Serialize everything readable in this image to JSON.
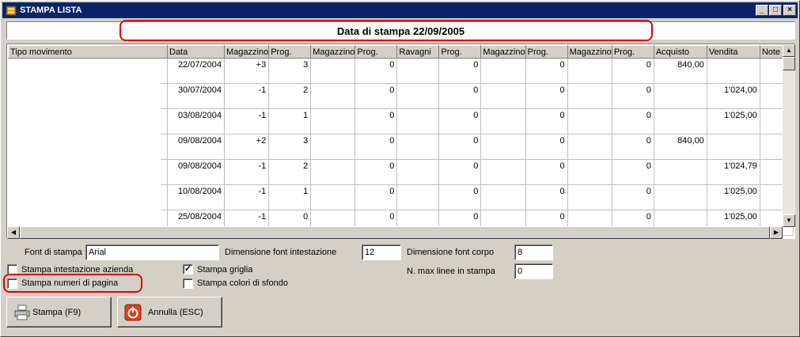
{
  "window": {
    "title": "STAMPA LISTA",
    "controls": {
      "minimize": "_",
      "maximize": "□",
      "close": "×"
    }
  },
  "header": {
    "text": "Data di stampa 22/09/2005"
  },
  "grid": {
    "columns": [
      "Tipo movimento",
      "Data",
      "Magazzino",
      "Prog.",
      "Magazzino",
      "Prog.",
      "Ravagni",
      "Prog.",
      "Magazzino",
      "Prog.",
      "Magazzino",
      "Prog.",
      "Acquisto",
      "Vendita",
      "Note"
    ],
    "rows": [
      [
        "",
        "22/07/2004",
        "+3",
        "3",
        "",
        "0",
        "",
        "0",
        "",
        "0",
        "",
        "0",
        "840,00",
        "",
        ""
      ],
      [
        "",
        "30/07/2004",
        "-1",
        "2",
        "",
        "0",
        "",
        "0",
        "",
        "0",
        "",
        "0",
        "",
        "1'024,00",
        ""
      ],
      [
        "",
        "03/08/2004",
        "-1",
        "1",
        "",
        "0",
        "",
        "0",
        "",
        "0",
        "",
        "0",
        "",
        "1'025,00",
        ""
      ],
      [
        "",
        "09/08/2004",
        "+2",
        "3",
        "",
        "0",
        "",
        "0",
        "",
        "0",
        "",
        "0",
        "840,00",
        "",
        ""
      ],
      [
        "",
        "09/08/2004",
        "-1",
        "2",
        "",
        "0",
        "",
        "0",
        "",
        "0",
        "",
        "0",
        "",
        "1'024,79",
        ""
      ],
      [
        "",
        "10/08/2004",
        "-1",
        "1",
        "",
        "0",
        "",
        "0",
        "",
        "0",
        "",
        "0",
        "",
        "1'025,00",
        ""
      ],
      [
        "",
        "25/08/2004",
        "-1",
        "0",
        "",
        "0",
        "",
        "0",
        "",
        "0",
        "",
        "0",
        "",
        "1'025,00",
        ""
      ]
    ]
  },
  "options": {
    "font_label": "Font di stampa :",
    "font_value": "Arial",
    "header_font_label": "Dimensione font intestazione",
    "header_font_value": "12",
    "body_font_label": "Dimensione font corpo",
    "body_font_value": "8",
    "max_lines_label": "N. max linee in stampa",
    "max_lines_value": "0",
    "print_company_header": {
      "label": "Stampa intestazione azienda",
      "checked": false
    },
    "print_page_numbers": {
      "label": "Stampa numeri di pagina",
      "checked": false
    },
    "print_grid": {
      "label": "Stampa griglia",
      "checked": true
    },
    "print_bg_colors": {
      "label": "Stampa colori di sfondo",
      "checked": false
    }
  },
  "buttons": {
    "print": "Stampa (F9)",
    "cancel": "Annulla (ESC)"
  },
  "colors": {
    "titlebar": "#0a246a",
    "highlight": "#e00000",
    "face": "#d4d0c8"
  }
}
